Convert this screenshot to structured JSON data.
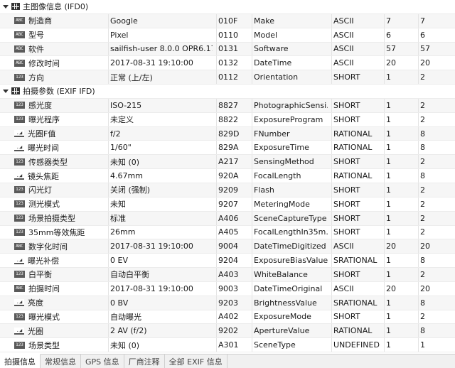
{
  "groups": [
    {
      "title": "主图像信息 (IFD0)",
      "rows": [
        {
          "badge": "ABC",
          "name": "制造商",
          "value": "Google",
          "tag": "010F",
          "field": "Make",
          "type": "ASCII",
          "n1": "7",
          "n2": "7"
        },
        {
          "badge": "ABC",
          "name": "型号",
          "value": "Pixel",
          "tag": "0110",
          "field": "Model",
          "type": "ASCII",
          "n1": "6",
          "n2": "6"
        },
        {
          "badge": "ABC",
          "name": "软件",
          "value": "sailfish-user 8.0.0 OPR6.17...",
          "tag": "0131",
          "field": "Software",
          "type": "ASCII",
          "n1": "57",
          "n2": "57"
        },
        {
          "badge": "ABC",
          "name": "修改时间",
          "value": "2017-08-31 19:10:00",
          "tag": "0132",
          "field": "DateTime",
          "type": "ASCII",
          "n1": "20",
          "n2": "20"
        },
        {
          "badge": "123",
          "name": "方向",
          "value": "正常 (上/左)",
          "tag": "0112",
          "field": "Orientation",
          "type": "SHORT",
          "n1": "1",
          "n2": "2"
        }
      ]
    },
    {
      "title": "拍摄参数 (EXIF IFD)",
      "rows": [
        {
          "badge": "123",
          "name": "感光度",
          "value": "ISO-215",
          "tag": "8827",
          "field": "PhotographicSensi...",
          "type": "SHORT",
          "n1": "1",
          "n2": "2"
        },
        {
          "badge": "123",
          "name": "曝光程序",
          "value": "未定义",
          "tag": "8822",
          "field": "ExposureProgram",
          "type": "SHORT",
          "n1": "1",
          "n2": "2"
        },
        {
          "badge": "RAT",
          "name": "光圈F值",
          "value": "f/2",
          "tag": "829D",
          "field": "FNumber",
          "type": "RATIONAL",
          "n1": "1",
          "n2": "8"
        },
        {
          "badge": "RAT",
          "name": "曝光时间",
          "value": "1/60\"",
          "tag": "829A",
          "field": "ExposureTime",
          "type": "RATIONAL",
          "n1": "1",
          "n2": "8"
        },
        {
          "badge": "123",
          "name": "传感器类型",
          "value": "未知 (0)",
          "tag": "A217",
          "field": "SensingMethod",
          "type": "SHORT",
          "n1": "1",
          "n2": "2"
        },
        {
          "badge": "RAT",
          "name": "镜头焦距",
          "value": "4.67mm",
          "tag": "920A",
          "field": "FocalLength",
          "type": "RATIONAL",
          "n1": "1",
          "n2": "8"
        },
        {
          "badge": "123",
          "name": "闪光灯",
          "value": "关闭 (强制)",
          "tag": "9209",
          "field": "Flash",
          "type": "SHORT",
          "n1": "1",
          "n2": "2"
        },
        {
          "badge": "123",
          "name": "测光模式",
          "value": "未知",
          "tag": "9207",
          "field": "MeteringMode",
          "type": "SHORT",
          "n1": "1",
          "n2": "2"
        },
        {
          "badge": "123",
          "name": "场景拍摄类型",
          "value": "标准",
          "tag": "A406",
          "field": "SceneCaptureType",
          "type": "SHORT",
          "n1": "1",
          "n2": "2"
        },
        {
          "badge": "123",
          "name": "35mm等效焦距",
          "value": "26mm",
          "tag": "A405",
          "field": "FocalLengthIn35m...",
          "type": "SHORT",
          "n1": "1",
          "n2": "2"
        },
        {
          "badge": "ABC",
          "name": "数字化时间",
          "value": "2017-08-31 19:10:00",
          "tag": "9004",
          "field": "DateTimeDigitized",
          "type": "ASCII",
          "n1": "20",
          "n2": "20"
        },
        {
          "badge": "RAT",
          "name": "曝光补偿",
          "value": "0 EV",
          "tag": "9204",
          "field": "ExposureBiasValue",
          "type": "SRATIONAL",
          "n1": "1",
          "n2": "8"
        },
        {
          "badge": "123",
          "name": "白平衡",
          "value": "自动白平衡",
          "tag": "A403",
          "field": "WhiteBalance",
          "type": "SHORT",
          "n1": "1",
          "n2": "2"
        },
        {
          "badge": "ABC",
          "name": "拍摄时间",
          "value": "2017-08-31 19:10:00",
          "tag": "9003",
          "field": "DateTimeOriginal",
          "type": "ASCII",
          "n1": "20",
          "n2": "20"
        },
        {
          "badge": "RAT",
          "name": "亮度",
          "value": "0 BV",
          "tag": "9203",
          "field": "BrightnessValue",
          "type": "SRATIONAL",
          "n1": "1",
          "n2": "8"
        },
        {
          "badge": "123",
          "name": "曝光模式",
          "value": "自动曝光",
          "tag": "A402",
          "field": "ExposureMode",
          "type": "SHORT",
          "n1": "1",
          "n2": "2"
        },
        {
          "badge": "RAT",
          "name": "光圈",
          "value": "2 AV (f/2)",
          "tag": "9202",
          "field": "ApertureValue",
          "type": "RATIONAL",
          "n1": "1",
          "n2": "8"
        },
        {
          "badge": "123",
          "name": "场景类型",
          "value": "未知 (0)",
          "tag": "A301",
          "field": "SceneType",
          "type": "UNDEFINED",
          "n1": "1",
          "n2": "1"
        }
      ]
    }
  ],
  "tabs": [
    "拍摄信息",
    "常规信息",
    "GPS 信息",
    "厂商注释",
    "全部 EXIF 信息"
  ],
  "active_tab": 0
}
